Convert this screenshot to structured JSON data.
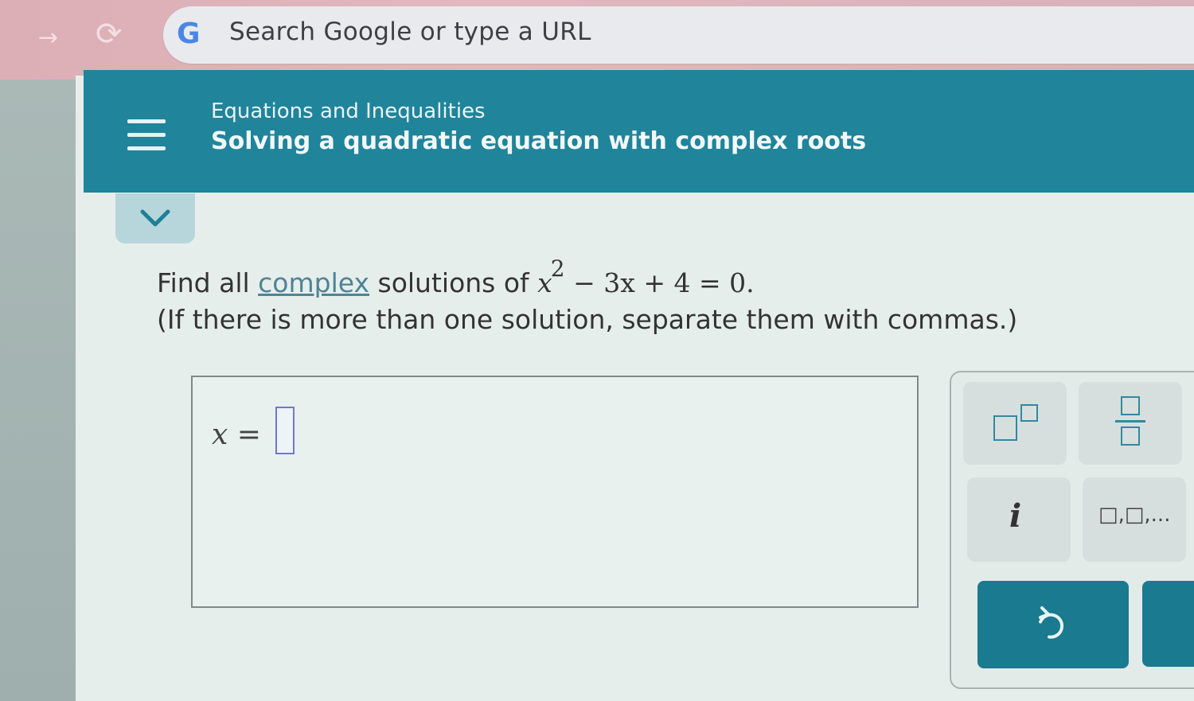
{
  "browser": {
    "omnibox_placeholder": "Search Google or type a URL",
    "google_logo": "G",
    "forward_icon": "→",
    "reload_icon": "C"
  },
  "header": {
    "subtitle": "Equations and Inequalities",
    "title": "Solving a quadratic equation with complex roots"
  },
  "question": {
    "prefix": "Find all ",
    "link": "complex",
    "middle": " solutions of ",
    "eq_x": "x",
    "eq_exp": "2",
    "eq_rest": " − 3x + 4 = 0.",
    "line2": "(If there is more than one solution, separate them with commas.)"
  },
  "answer": {
    "label_var": "x",
    "label_eq": " = ",
    "value": ""
  },
  "keypad": {
    "keys": [
      {
        "name": "exponent",
        "icon": "exponent-icon"
      },
      {
        "name": "fraction",
        "icon": "fraction-icon"
      },
      {
        "name": "imaginary",
        "label": "i"
      },
      {
        "name": "list",
        "label": "□,□,..."
      }
    ],
    "undo_icon": "undo-icon",
    "accent": "#1a7a8f"
  },
  "colors": {
    "header_bg": "#20849b",
    "link": "#4f8396"
  }
}
